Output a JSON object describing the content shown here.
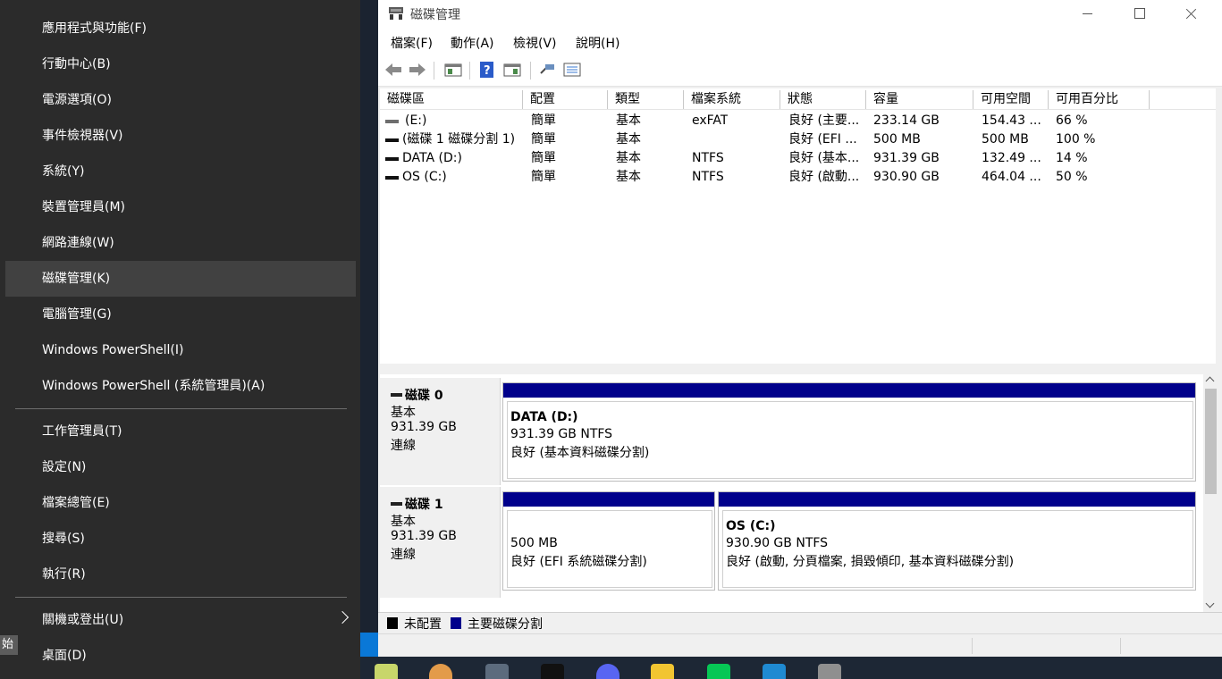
{
  "winx_menu": {
    "items": [
      {
        "label": "應用程式與功能(F)"
      },
      {
        "label": "行動中心(B)"
      },
      {
        "label": "電源選項(O)"
      },
      {
        "label": "事件檢視器(V)"
      },
      {
        "label": "系統(Y)"
      },
      {
        "label": "裝置管理員(M)"
      },
      {
        "label": "網路連線(W)"
      },
      {
        "label": "磁碟管理(K)"
      },
      {
        "label": "電腦管理(G)"
      },
      {
        "label": "Windows PowerShell(I)"
      },
      {
        "label": "Windows PowerShell (系統管理員)(A)"
      },
      {
        "label": "工作管理員(T)"
      },
      {
        "label": "設定(N)"
      },
      {
        "label": "檔案總管(E)"
      },
      {
        "label": "搜尋(S)"
      },
      {
        "label": "執行(R)"
      },
      {
        "label": "關機或登出(U)"
      },
      {
        "label": "桌面(D)"
      }
    ],
    "highlighted_item": "磁碟管理(K)",
    "start_stub": "始"
  },
  "window": {
    "title": "磁碟管理",
    "menu": [
      "檔案(F)",
      "動作(A)",
      "檢視(V)",
      "說明(H)"
    ],
    "toolbar_icons": [
      "back-arrow-icon",
      "forward-arrow-icon",
      "console-tree-icon",
      "help-icon",
      "properties-icon",
      "rescan-icon",
      "settings-list-icon"
    ]
  },
  "volume_list": {
    "columns": [
      "磁碟區",
      "配置",
      "類型",
      "檔案系統",
      "狀態",
      "容量",
      "可用空間",
      "可用百分比"
    ],
    "rows": [
      {
        "name": "(E:)",
        "layout": "簡單",
        "type": "基本",
        "fs": "exFAT",
        "status": "良好 (主要...",
        "capacity": "233.14 GB",
        "free": "154.43 ...",
        "pct": "66 %",
        "icon": "volume-icon"
      },
      {
        "name": "(磁碟 1 磁碟分割 1)",
        "layout": "簡單",
        "type": "基本",
        "fs": "",
        "status": "良好 (EFI ...",
        "capacity": "500 MB",
        "free": "500 MB",
        "pct": "100 %",
        "icon": "volume-icon"
      },
      {
        "name": "DATA (D:)",
        "layout": "簡單",
        "type": "基本",
        "fs": "NTFS",
        "status": "良好 (基本...",
        "capacity": "931.39 GB",
        "free": "132.49 ...",
        "pct": "14 %",
        "icon": "volume-icon"
      },
      {
        "name": "OS (C:)",
        "layout": "簡單",
        "type": "基本",
        "fs": "NTFS",
        "status": "良好 (啟動...",
        "capacity": "930.90 GB",
        "free": "464.04 ...",
        "pct": "50 %",
        "icon": "volume-icon"
      }
    ]
  },
  "disks": [
    {
      "name": "磁碟 0",
      "kind": "基本",
      "size": "931.39 GB",
      "state": "連線",
      "partitions": [
        {
          "title": "DATA  (D:)",
          "size_fs": "931.39 GB NTFS",
          "status": "良好 (基本資料磁碟分割)"
        }
      ]
    },
    {
      "name": "磁碟 1",
      "kind": "基本",
      "size": "931.39 GB",
      "state": "連線",
      "partitions": [
        {
          "title": "",
          "size_fs": "500 MB",
          "status": "良好 (EFI 系統磁碟分割)"
        },
        {
          "title": "OS  (C:)",
          "size_fs": "930.90 GB NTFS",
          "status": "良好 (啟動, 分頁檔案, 損毀傾印, 基本資料磁碟分割)"
        }
      ]
    }
  ],
  "legend": [
    {
      "label": "未配置",
      "color": "#000000"
    },
    {
      "label": "主要磁碟分割",
      "color": "#00008b"
    }
  ],
  "colors": {
    "menu_bg": "#2b2b2b",
    "menu_highlight": "#414141",
    "primary_partition": "#00008b"
  }
}
